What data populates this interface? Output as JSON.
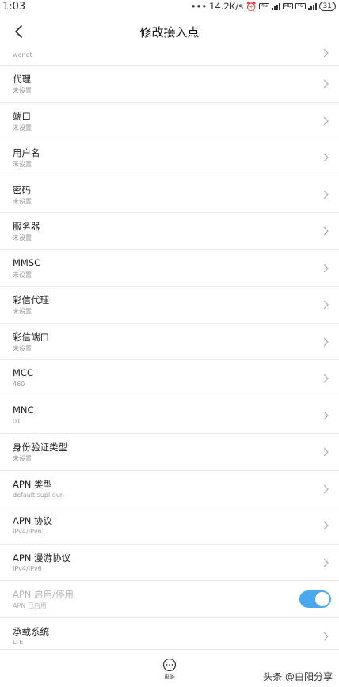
{
  "status_bar": {
    "time": "1:03",
    "net_speed": "14.2K/s",
    "tag_volte": "4G",
    "tag_hd": "HD",
    "tag_4g": "4G",
    "battery": "31"
  },
  "header": {
    "title": "修改接入点"
  },
  "list": {
    "partial": {
      "value": "wonet"
    },
    "items": [
      {
        "label": "代理",
        "value": "未设置"
      },
      {
        "label": "端口",
        "value": "未设置"
      },
      {
        "label": "用户名",
        "value": "未设置"
      },
      {
        "label": "密码",
        "value": "未设置"
      },
      {
        "label": "服务器",
        "value": "未设置"
      },
      {
        "label": "MMSC",
        "value": "未设置"
      },
      {
        "label": "彩信代理",
        "value": "未设置"
      },
      {
        "label": "彩信端口",
        "value": "未设置"
      },
      {
        "label": "MCC",
        "value": "460"
      },
      {
        "label": "MNC",
        "value": "01"
      },
      {
        "label": "身份验证类型",
        "value": "未设置"
      },
      {
        "label": "APN 类型",
        "value": "default,supl,dun"
      },
      {
        "label": "APN 协议",
        "value": "IPv4/IPv6"
      },
      {
        "label": "APN 漫游协议",
        "value": "IPv4/IPv6"
      }
    ],
    "toggle_item": {
      "label": "APN 启用/停用",
      "value": "APN 已启用",
      "on": true
    },
    "bearer": {
      "label": "承载系统",
      "value": "LTE"
    }
  },
  "bottom_bar": {
    "more_label": "更多"
  },
  "watermark": "头条 @白阳分享",
  "colors": {
    "toggle_on": "#4aa8ee",
    "divider": "#ebebeb"
  }
}
